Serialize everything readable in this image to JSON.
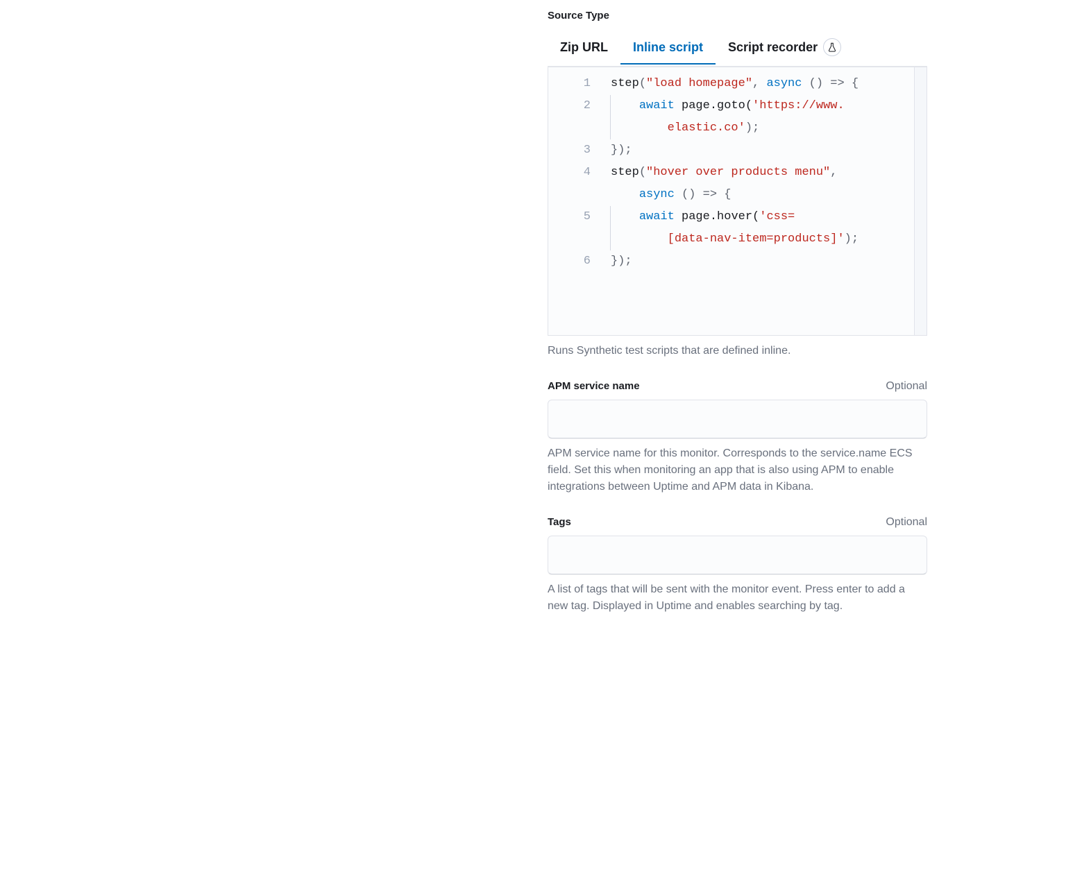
{
  "sourceType": {
    "label": "Source Type",
    "tabs": [
      {
        "id": "zip-url",
        "label": "Zip URL",
        "active": false,
        "badge": null
      },
      {
        "id": "inline-script",
        "label": "Inline script",
        "active": true,
        "badge": null
      },
      {
        "id": "script-recorder",
        "label": "Script recorder",
        "active": false,
        "badge": "beaker"
      }
    ],
    "helper": "Runs Synthetic test scripts that are defined inline.",
    "code": {
      "lines": [
        {
          "n": 1,
          "tokens": [
            {
              "t": "step",
              "c": "fn"
            },
            {
              "t": "(",
              "c": "pun"
            },
            {
              "t": "\"load homepage\"",
              "c": "str"
            },
            {
              "t": ", ",
              "c": "pun"
            },
            {
              "t": "async",
              "c": "kw"
            },
            {
              "t": " () ",
              "c": "pun"
            },
            {
              "t": "=>",
              "c": "pun"
            },
            {
              "t": " {",
              "c": "pun"
            }
          ]
        },
        {
          "n": 2,
          "wrap": true,
          "indent": 1,
          "tokens": [
            {
              "t": "await",
              "c": "kw"
            },
            {
              "t": " page.goto(",
              "c": "fn"
            },
            {
              "t": "'https://www.elastic.co'",
              "c": "str"
            },
            {
              "t": ");",
              "c": "pun"
            }
          ]
        },
        {
          "n": 3,
          "tokens": [
            {
              "t": "});",
              "c": "pun"
            }
          ]
        },
        {
          "n": 4,
          "wrap": true,
          "tokens": [
            {
              "t": "step",
              "c": "fn"
            },
            {
              "t": "(",
              "c": "pun"
            },
            {
              "t": "\"hover over products menu\"",
              "c": "str"
            },
            {
              "t": ", ",
              "c": "pun"
            },
            {
              "t": "async",
              "c": "kw"
            },
            {
              "t": " () ",
              "c": "pun"
            },
            {
              "t": "=>",
              "c": "pun"
            },
            {
              "t": " {",
              "c": "pun"
            }
          ]
        },
        {
          "n": 5,
          "wrap": true,
          "indent": 1,
          "tokens": [
            {
              "t": "await",
              "c": "kw"
            },
            {
              "t": " page.hover(",
              "c": "fn"
            },
            {
              "t": "'css=[data-nav-item=products]'",
              "c": "str"
            },
            {
              "t": ");",
              "c": "pun"
            }
          ]
        },
        {
          "n": 6,
          "tokens": [
            {
              "t": "});",
              "c": "pun"
            }
          ]
        }
      ]
    }
  },
  "apm": {
    "label": "APM service name",
    "optional": "Optional",
    "value": "",
    "helper": "APM service name for this monitor. Corresponds to the service.name ECS field. Set this when monitoring an app that is also using APM to enable integrations between Uptime and APM data in Kibana."
  },
  "tags": {
    "label": "Tags",
    "optional": "Optional",
    "value": "",
    "helper": "A list of tags that will be sent with the monitor event. Press enter to add a new tag. Displayed in Uptime and enables searching by tag."
  }
}
